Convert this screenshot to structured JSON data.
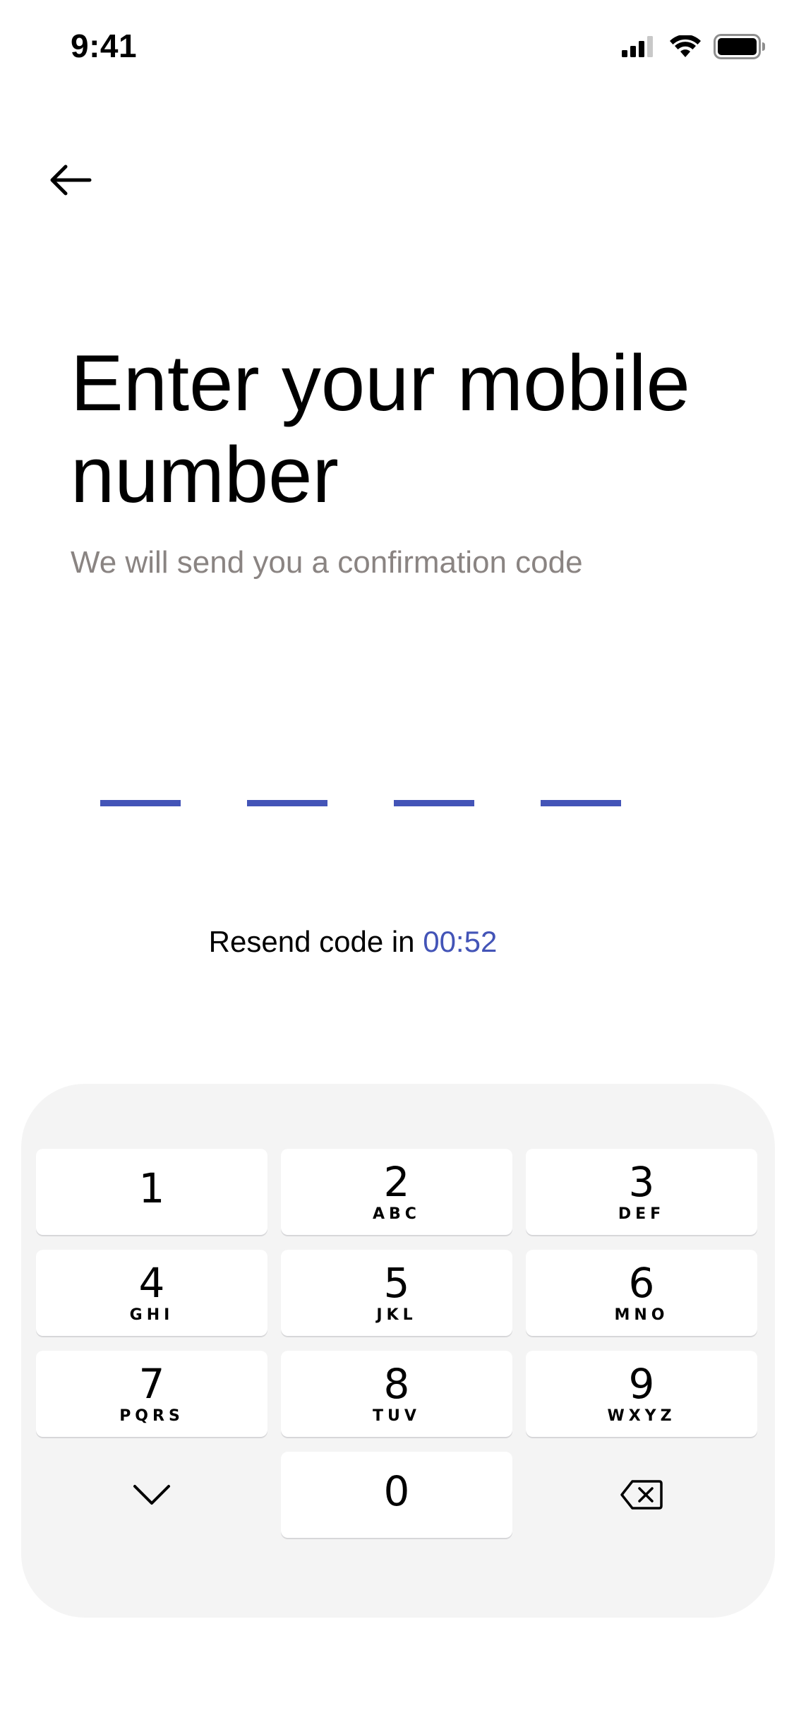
{
  "status_bar": {
    "time": "9:41",
    "icons": [
      "cellular-signal-icon",
      "wifi-icon",
      "battery-icon"
    ]
  },
  "header": {
    "back_icon": "arrow-left-icon"
  },
  "main": {
    "title": "Enter your mobile number",
    "subtitle": "We will send you a confirmation code",
    "code_slot_count": 4,
    "resend_label": "Resend code in ",
    "resend_timer": "00:52"
  },
  "keypad": {
    "keys": [
      {
        "digit": "1",
        "letters": ""
      },
      {
        "digit": "2",
        "letters": "ABC"
      },
      {
        "digit": "3",
        "letters": "DEF"
      },
      {
        "digit": "4",
        "letters": "GHI"
      },
      {
        "digit": "5",
        "letters": "JKL"
      },
      {
        "digit": "6",
        "letters": "MNO"
      },
      {
        "digit": "7",
        "letters": "PQRS"
      },
      {
        "digit": "8",
        "letters": "TUV"
      },
      {
        "digit": "9",
        "letters": "WXYZ"
      },
      {
        "digit": "0",
        "letters": ""
      }
    ],
    "hide_icon": "chevron-down-icon",
    "delete_icon": "backspace-icon"
  },
  "colors": {
    "accent": "#4354b7",
    "subtitle": "#8a8482",
    "keypad_background": "#f4f4f4"
  }
}
